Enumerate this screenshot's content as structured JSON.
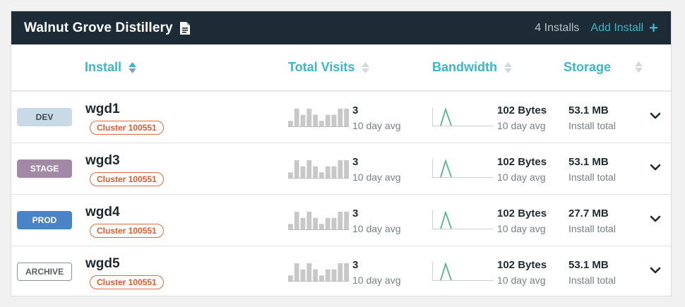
{
  "header": {
    "title": "Walnut Grove Distillery",
    "install_count": "4 Installs",
    "add_install_label": "Add Install",
    "add_icon": "+"
  },
  "columns": {
    "install": "Install",
    "total_visits": "Total Visits",
    "bandwidth": "Bandwidth",
    "storage": "Storage"
  },
  "colors": {
    "brand_dark": "#1c2b35",
    "accent": "#3cb6c9",
    "cluster": "#e05a2b",
    "sparkline_visits": "#c8c8c8",
    "sparkline_bandwidth": "#52b788",
    "dev": "#c9d9e6",
    "stage": "#a289a6",
    "prod": "#4a83c6"
  },
  "visits_sparkline_values": [
    1,
    3,
    2,
    3,
    2,
    1,
    2,
    2,
    3,
    3
  ],
  "installs": [
    {
      "env": "DEV",
      "name": "wgd1",
      "cluster": "Cluster 100551",
      "visits": "3",
      "visits_sub": "10 day avg",
      "bandwidth": "102 Bytes",
      "bandwidth_sub": "10 day avg",
      "storage": "53.1 MB",
      "storage_sub": "Install total"
    },
    {
      "env": "STAGE",
      "name": "wgd3",
      "cluster": "Cluster 100551",
      "visits": "3",
      "visits_sub": "10 day avg",
      "bandwidth": "102 Bytes",
      "bandwidth_sub": "10 day avg",
      "storage": "53.1 MB",
      "storage_sub": "Install total"
    },
    {
      "env": "PROD",
      "name": "wgd4",
      "cluster": "Cluster 100551",
      "visits": "3",
      "visits_sub": "10 day avg",
      "bandwidth": "102 Bytes",
      "bandwidth_sub": "10 day avg",
      "storage": "27.7 MB",
      "storage_sub": "Install total"
    },
    {
      "env": "ARCHIVE",
      "name": "wgd5",
      "cluster": "Cluster 100551",
      "visits": "3",
      "visits_sub": "10 day avg",
      "bandwidth": "102 Bytes",
      "bandwidth_sub": "10 day avg",
      "storage": "53.1 MB",
      "storage_sub": "Install total"
    }
  ]
}
